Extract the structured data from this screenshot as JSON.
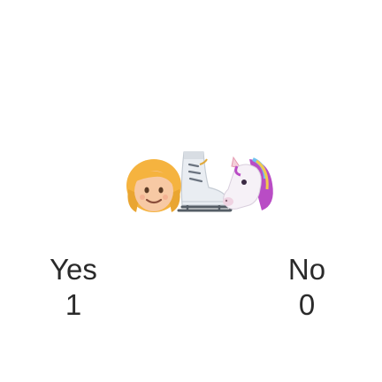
{
  "emojis": [
    {
      "name": "girl-emoji",
      "glyph": "girl"
    },
    {
      "name": "ice-skate-emoji",
      "glyph": "ice skate"
    },
    {
      "name": "unicorn-emoji",
      "glyph": "unicorn"
    }
  ],
  "answers": {
    "yes": {
      "label": "Yes",
      "count": "1"
    },
    "no": {
      "label": "No",
      "count": "0"
    }
  },
  "colors": {
    "background": "#ffffff",
    "text": "#2a2a2a",
    "girl_hair": "#f5b33f",
    "girl_skin": "#f7c9a4",
    "skate_body": "#e9edf2",
    "skate_blade": "#555d66",
    "unicorn_mane": "#b94cc5",
    "unicorn_body": "#f6f1f7",
    "unicorn_horn": "#f3cfd9"
  }
}
